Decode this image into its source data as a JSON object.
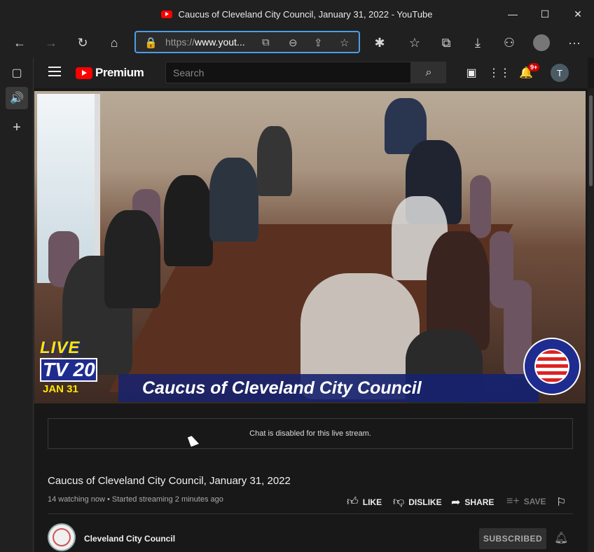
{
  "window": {
    "title": "Caucus of Cleveland City Council, January 31, 2022 - YouTube",
    "controls": {
      "minimize": "—",
      "maximize": "☐",
      "close": "✕"
    }
  },
  "browser": {
    "url_scheme": "https://",
    "url_host": "www.yout...",
    "icons": {
      "back": "←",
      "forward": "→",
      "refresh": "↻",
      "home": "⌂",
      "lock": "🔒",
      "extensions": "⧉",
      "zoom": "⊖",
      "share": "⇪",
      "favorite": "☆",
      "puzzle": "✱",
      "favorites": "☆",
      "collections": "⧉",
      "downloads": "⤓",
      "copilot": "⚇",
      "more": "···"
    }
  },
  "sidebar": {
    "tabs_icon": "▢",
    "audio_icon": "🔊",
    "add_icon": "+"
  },
  "youtube": {
    "logo_text": "Premium",
    "search_placeholder": "Search",
    "notif_badge": "9+",
    "avatar_letter": "T"
  },
  "video": {
    "live_word": "LIVE",
    "channel_id": "TV 20",
    "date_tag": "JAN 31",
    "banner": "Caucus of Cleveland City Council"
  },
  "chat": {
    "message": "Chat is disabled for this live stream."
  },
  "details": {
    "title": "Caucus of Cleveland City Council, January 31, 2022",
    "meta": "14 watching now • Started streaming 2 minutes ago",
    "like": "LIKE",
    "dislike": "DISLIKE",
    "share": "SHARE",
    "save": "SAVE"
  },
  "channel": {
    "name": "Cleveland City Council",
    "subscribe_label": "SUBSCRIBED"
  },
  "colors": {
    "accent": "#4c9de8",
    "yt_red": "#ff0000",
    "banner_blue": "#1f2c8f",
    "live_yellow": "#ffe600"
  }
}
